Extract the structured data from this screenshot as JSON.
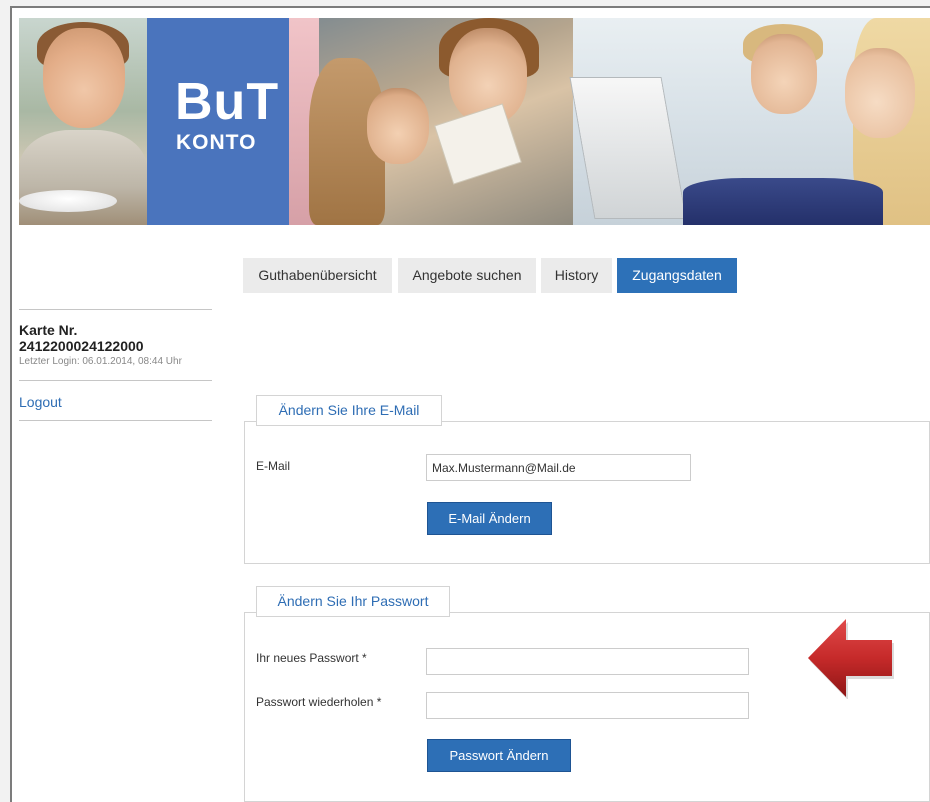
{
  "banner": {
    "logo_main": "BuT",
    "logo_sub": "KONTO"
  },
  "sidebar": {
    "card_label": "Karte Nr.",
    "card_number": "2412200024122000",
    "last_login": "Letzter Login: 06.01.2014, 08:44 Uhr",
    "logout": "Logout"
  },
  "tabs": [
    {
      "label": "Guthabenübersicht",
      "active": false
    },
    {
      "label": "Angebote suchen",
      "active": false
    },
    {
      "label": "History",
      "active": false
    },
    {
      "label": "Zugangsdaten",
      "active": true
    }
  ],
  "email_section": {
    "title": "Ändern Sie Ihre E-Mail",
    "email_label": "E-Mail",
    "email_value": "Max.Mustermann@Mail.de",
    "submit": "E-Mail Ändern"
  },
  "password_section": {
    "title": "Ändern Sie Ihr Passwort",
    "new_password_label": "Ihr neues Passwort *",
    "new_password_value": "",
    "repeat_password_label": "Passwort wiederholen *",
    "repeat_password_value": "",
    "submit": "Passwort Ändern"
  },
  "colors": {
    "accent": "#2d71b8",
    "logo_bg": "#4a74bd",
    "arrow": "#c62a2a"
  }
}
